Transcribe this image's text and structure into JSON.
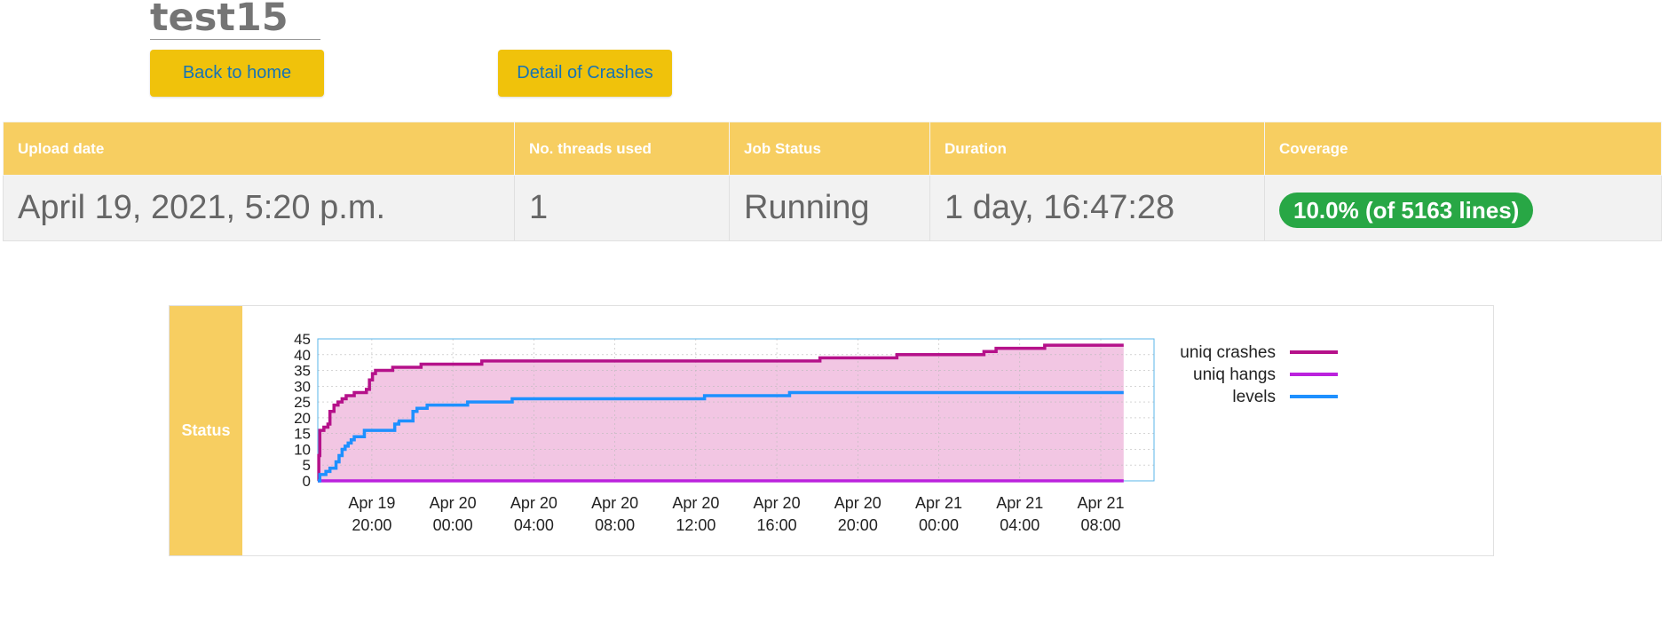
{
  "page": {
    "title": "test15"
  },
  "buttons": {
    "home_label": "Back to home",
    "crashes_label": "Detail of Crashes"
  },
  "job_table": {
    "headers": [
      "Upload date",
      "No. threads used",
      "Job Status",
      "Duration",
      "Coverage"
    ],
    "row": {
      "upload_date": "April 19, 2021, 5:20 p.m.",
      "threads": "1",
      "status": "Running",
      "duration": "1 day, 16:47:28",
      "coverage": "10.0% (of 5163 lines)"
    },
    "coverage_color": "#28a745"
  },
  "status": {
    "label": "Status"
  },
  "colors": {
    "accent": "#f0c20b",
    "header_bg": "#f7ce61",
    "link": "#1673b5"
  },
  "chart_data": {
    "type": "line",
    "title": "",
    "ylim": [
      0,
      45
    ],
    "yticks": [
      "45",
      "40",
      "35",
      "30",
      "25",
      "20",
      "15",
      "10",
      "5",
      "0"
    ],
    "xlim": [
      0,
      41.3
    ],
    "xticks": [
      {
        "t": 2.67,
        "label1": "Apr 19",
        "label2": "20:00"
      },
      {
        "t": 6.67,
        "label1": "Apr 20",
        "label2": "00:00"
      },
      {
        "t": 10.67,
        "label1": "Apr 20",
        "label2": "04:00"
      },
      {
        "t": 14.67,
        "label1": "Apr 20",
        "label2": "08:00"
      },
      {
        "t": 18.67,
        "label1": "Apr 20",
        "label2": "12:00"
      },
      {
        "t": 22.67,
        "label1": "Apr 20",
        "label2": "16:00"
      },
      {
        "t": 26.67,
        "label1": "Apr 20",
        "label2": "20:00"
      },
      {
        "t": 30.67,
        "label1": "Apr 21",
        "label2": "00:00"
      },
      {
        "t": 34.67,
        "label1": "Apr 21",
        "label2": "04:00"
      },
      {
        "t": 38.67,
        "label1": "Apr 21",
        "label2": "08:00"
      }
    ],
    "grid": true,
    "legend_position": "right",
    "series": [
      {
        "name": "uniq crashes",
        "color": "#b5118a",
        "fill": "#f2c6e3",
        "step": true,
        "points": [
          [
            0,
            0
          ],
          [
            0.05,
            8
          ],
          [
            0.1,
            16
          ],
          [
            0.3,
            17
          ],
          [
            0.5,
            18
          ],
          [
            0.6,
            22
          ],
          [
            0.8,
            24
          ],
          [
            1.0,
            25
          ],
          [
            1.2,
            26
          ],
          [
            1.4,
            27
          ],
          [
            1.8,
            28
          ],
          [
            2.2,
            28
          ],
          [
            2.4,
            29
          ],
          [
            2.55,
            32
          ],
          [
            2.7,
            34
          ],
          [
            2.85,
            35
          ],
          [
            3.6,
            35
          ],
          [
            3.7,
            36
          ],
          [
            5.0,
            36
          ],
          [
            5.1,
            37
          ],
          [
            8.0,
            37
          ],
          [
            8.1,
            38
          ],
          [
            24.7,
            38
          ],
          [
            24.8,
            39
          ],
          [
            28.5,
            39
          ],
          [
            28.6,
            40
          ],
          [
            32.8,
            40
          ],
          [
            32.9,
            41
          ],
          [
            33.4,
            41
          ],
          [
            33.5,
            42
          ],
          [
            35.8,
            42
          ],
          [
            35.9,
            43
          ],
          [
            39.8,
            43
          ]
        ]
      },
      {
        "name": "uniq hangs",
        "color": "#bb22dd",
        "step": true,
        "points": [
          [
            0,
            0
          ],
          [
            39.8,
            0
          ]
        ]
      },
      {
        "name": "levels",
        "color": "#1e90ff",
        "step": true,
        "points": [
          [
            0,
            0
          ],
          [
            0.1,
            2
          ],
          [
            0.4,
            3
          ],
          [
            0.6,
            4
          ],
          [
            0.9,
            6
          ],
          [
            1.05,
            8
          ],
          [
            1.2,
            10
          ],
          [
            1.35,
            11
          ],
          [
            1.5,
            12
          ],
          [
            1.65,
            13
          ],
          [
            1.8,
            14
          ],
          [
            2.2,
            14
          ],
          [
            2.3,
            16
          ],
          [
            3.0,
            16
          ],
          [
            3.7,
            16
          ],
          [
            3.8,
            18
          ],
          [
            4.0,
            19
          ],
          [
            3.95,
            19
          ],
          [
            4.6,
            19
          ],
          [
            4.7,
            22
          ],
          [
            4.9,
            23
          ],
          [
            5.3,
            23
          ],
          [
            5.4,
            24
          ],
          [
            7.3,
            24
          ],
          [
            7.4,
            25
          ],
          [
            9.5,
            25
          ],
          [
            9.6,
            26
          ],
          [
            19.0,
            26
          ],
          [
            19.1,
            27
          ],
          [
            23.2,
            27
          ],
          [
            23.3,
            28
          ],
          [
            39.8,
            28
          ]
        ]
      }
    ]
  }
}
